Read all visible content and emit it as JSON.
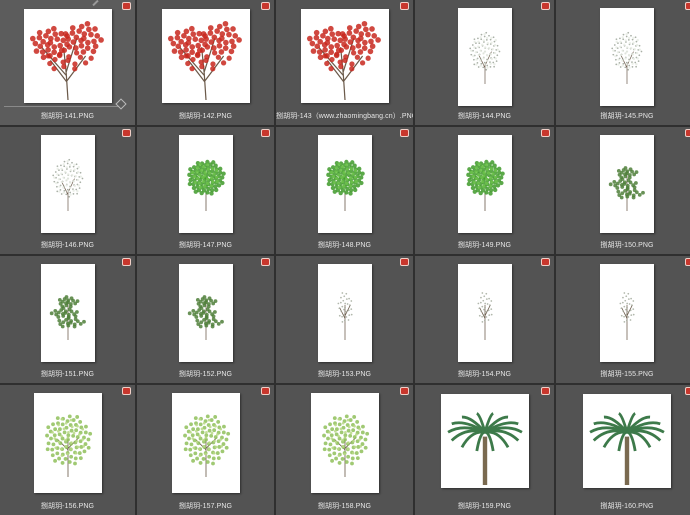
{
  "files": [
    {
      "name": "捌胡玥-141.PNG",
      "tree": "red",
      "shape": "square"
    },
    {
      "name": "捌胡玥-142.PNG",
      "tree": "red",
      "shape": "square"
    },
    {
      "name": "捌胡玥-143（www.zhaomingbang.cn）.PNG",
      "tree": "red",
      "shape": "square"
    },
    {
      "name": "捌胡玥-144.PNG",
      "tree": "white",
      "shape": "tall"
    },
    {
      "name": "捌胡玥-145.PNG",
      "tree": "white",
      "shape": "tall"
    },
    {
      "name": "捌胡玥-146.PNG",
      "tree": "white",
      "shape": "tall"
    },
    {
      "name": "捌胡玥-147.PNG",
      "tree": "green",
      "shape": "tall"
    },
    {
      "name": "捌胡玥-148.PNG",
      "tree": "green",
      "shape": "tall"
    },
    {
      "name": "捌胡玥-149.PNG",
      "tree": "green",
      "shape": "tall"
    },
    {
      "name": "捌胡玥-150.PNG",
      "tree": "pine",
      "shape": "tall"
    },
    {
      "name": "捌胡玥-151.PNG",
      "tree": "pine",
      "shape": "tall"
    },
    {
      "name": "捌胡玥-152.PNG",
      "tree": "pine",
      "shape": "tall"
    },
    {
      "name": "捌胡玥-153.PNG",
      "tree": "sparse",
      "shape": "tall"
    },
    {
      "name": "捌胡玥-154.PNG",
      "tree": "sparse",
      "shape": "tall"
    },
    {
      "name": "捌胡玥-155.PNG",
      "tree": "sparse",
      "shape": "tall"
    },
    {
      "name": "捌胡玥-156.PNG",
      "tree": "lightgreen",
      "shape": "mid"
    },
    {
      "name": "捌胡玥-157.PNG",
      "tree": "lightgreen",
      "shape": "mid"
    },
    {
      "name": "捌胡玥-158.PNG",
      "tree": "lightgreen",
      "shape": "mid"
    },
    {
      "name": "捌胡玥-159.PNG",
      "tree": "palm",
      "shape": "square"
    },
    {
      "name": "捌胡玥-160.PNG",
      "tree": "palm",
      "shape": "square"
    }
  ],
  "colors": {
    "red": "#c8281e",
    "green": "#3f9a2a",
    "pine": "#4f7f3a",
    "lightgreen": "#8fbf5a",
    "white": "#e8ece4",
    "palm": "#3d7a4a",
    "trunk": "#6b5a4a"
  }
}
